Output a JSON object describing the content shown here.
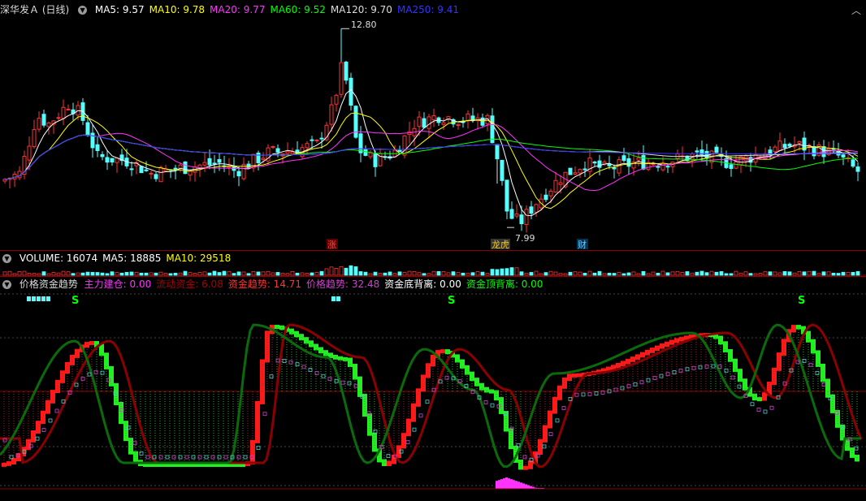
{
  "header": {
    "stock_name": "深华发Ａ (日线)",
    "ma": [
      {
        "label": "MA5: 9.57",
        "color": "#ffffff"
      },
      {
        "label": "MA10: 9.78",
        "color": "#ffff00"
      },
      {
        "label": "MA20: 9.77",
        "color": "#ff33ff"
      },
      {
        "label": "MA60: 9.52",
        "color": "#00ff00"
      },
      {
        "label": "MA120: 9.70",
        "color": "#dddddd"
      },
      {
        "label": "MA250: 9.41",
        "color": "#3333ff"
      }
    ],
    "collapse_icon": "chevron-up-icon"
  },
  "price_annotations": {
    "high": "12.80",
    "low": "7.99",
    "tag_zhang": "涨",
    "tag_longhu": "龙虎",
    "tag_cai": "财"
  },
  "volume": {
    "items": [
      {
        "label": "VOLUME: 16074",
        "color": "#ffffff"
      },
      {
        "label": "MA5: 18885",
        "color": "#ffffff"
      },
      {
        "label": "MA10: 29518",
        "color": "#ffff00"
      }
    ]
  },
  "indicator": {
    "name": "价格资金趋势",
    "items": [
      {
        "label": "主力建仓: 0.00",
        "color": "#ff33ff"
      },
      {
        "label": "流动资金: 6.08",
        "color": "#aa0000"
      },
      {
        "label": "资金趋势: 14.71",
        "color": "#ff3333"
      },
      {
        "label": "价格趋势: 32.48",
        "color": "#cc44cc"
      },
      {
        "label": "资金底背离: 0.00",
        "color": "#ffffff"
      },
      {
        "label": "资金顶背离: 0.00",
        "color": "#00ff00"
      }
    ],
    "signal_s": "S"
  },
  "colors": {
    "up": "#ff3333",
    "down": "#54ffff",
    "grid_red": "#8b0000"
  },
  "chart_data": {
    "type": "candlestick",
    "title": "深华发Ａ (日线)",
    "ylim": [
      7.6,
      13.1
    ],
    "high_label": 12.8,
    "low_label": 7.99,
    "ma_values": {
      "MA5": 9.57,
      "MA10": 9.78,
      "MA20": 9.77,
      "MA60": 9.52,
      "MA120": 9.7,
      "MA250": 9.41
    },
    "volume": {
      "VOLUME": 16074,
      "MA5": 18885,
      "MA10": 29518
    }
  }
}
